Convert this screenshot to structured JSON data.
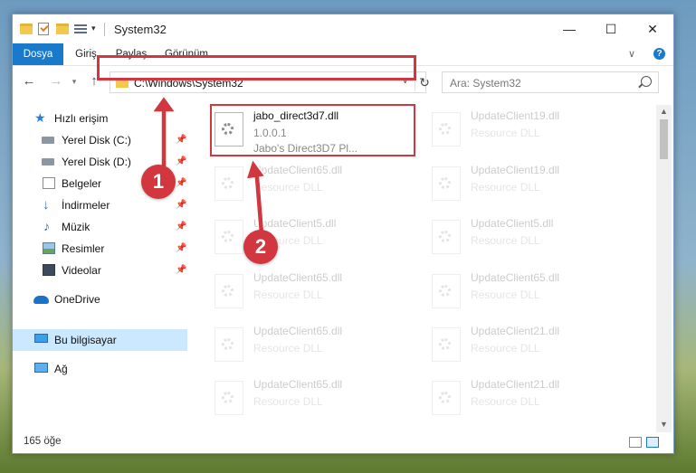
{
  "window": {
    "title": "System32",
    "minimize_glyph": "—",
    "maximize_glyph": "☐",
    "close_glyph": "✕"
  },
  "ribbon": {
    "tabs": [
      "Dosya",
      "Giriş",
      "Paylaş",
      "Görünüm"
    ],
    "active_tab": "Dosya",
    "help_glyph": "?"
  },
  "navigation": {
    "address": "C:\\Windows\\System32",
    "search_placeholder": "Ara: System32"
  },
  "sidebar": {
    "items": [
      {
        "label": "Hızlı erişim",
        "icon": "star-icon",
        "pinned": false
      },
      {
        "label": "Yerel Disk (C:)",
        "icon": "drive-icon",
        "pinned": true
      },
      {
        "label": "Yerel Disk (D:)",
        "icon": "drive-icon",
        "pinned": true
      },
      {
        "label": "Belgeler",
        "icon": "documents-icon",
        "pinned": true
      },
      {
        "label": "İndirmeler",
        "icon": "downloads-icon",
        "pinned": true
      },
      {
        "label": "Müzik",
        "icon": "music-icon",
        "pinned": true
      },
      {
        "label": "Resimler",
        "icon": "pictures-icon",
        "pinned": true
      },
      {
        "label": "Videolar",
        "icon": "videos-icon",
        "pinned": true
      },
      {
        "label": "OneDrive",
        "icon": "onedrive-icon",
        "pinned": false
      },
      {
        "label": "Bu bilgisayar",
        "icon": "this-pc-icon",
        "pinned": false,
        "selected": true
      },
      {
        "label": "Ağ",
        "icon": "network-icon",
        "pinned": false
      }
    ]
  },
  "files": {
    "left": [
      {
        "name": "jabo_direct3d7.dll",
        "version": "1.0.0.1",
        "description": "Jabo's Direct3D7 Pl..."
      },
      {
        "name": "UpdateClient65.dll",
        "version": "Resource DLL",
        "description": ""
      },
      {
        "name": "UpdateClient5.dll",
        "version": "Resource DLL",
        "description": ""
      },
      {
        "name": "UpdateClient65.dll",
        "version": "Resource DLL",
        "description": ""
      },
      {
        "name": "UpdateClient65.dll",
        "version": "Resource DLL",
        "description": ""
      },
      {
        "name": "UpdateClient65.dll",
        "version": "Resource DLL",
        "description": ""
      }
    ],
    "right": [
      {
        "name": "UpdateClient19.dll",
        "version": "Resource DLL"
      },
      {
        "name": "UpdateClient19.dll",
        "version": "Resource DLL"
      },
      {
        "name": "UpdateClient5.dll",
        "version": "Resource DLL"
      },
      {
        "name": "UpdateClient65.dll",
        "version": "Resource DLL"
      },
      {
        "name": "UpdateClient21.dll",
        "version": "Resource DLL"
      },
      {
        "name": "UpdateClient21.dll",
        "version": "Resource DLL"
      }
    ]
  },
  "status": {
    "item_count": "165 öğe"
  },
  "annotations": {
    "step1": "1",
    "step2": "2",
    "color": "#d2363e"
  }
}
